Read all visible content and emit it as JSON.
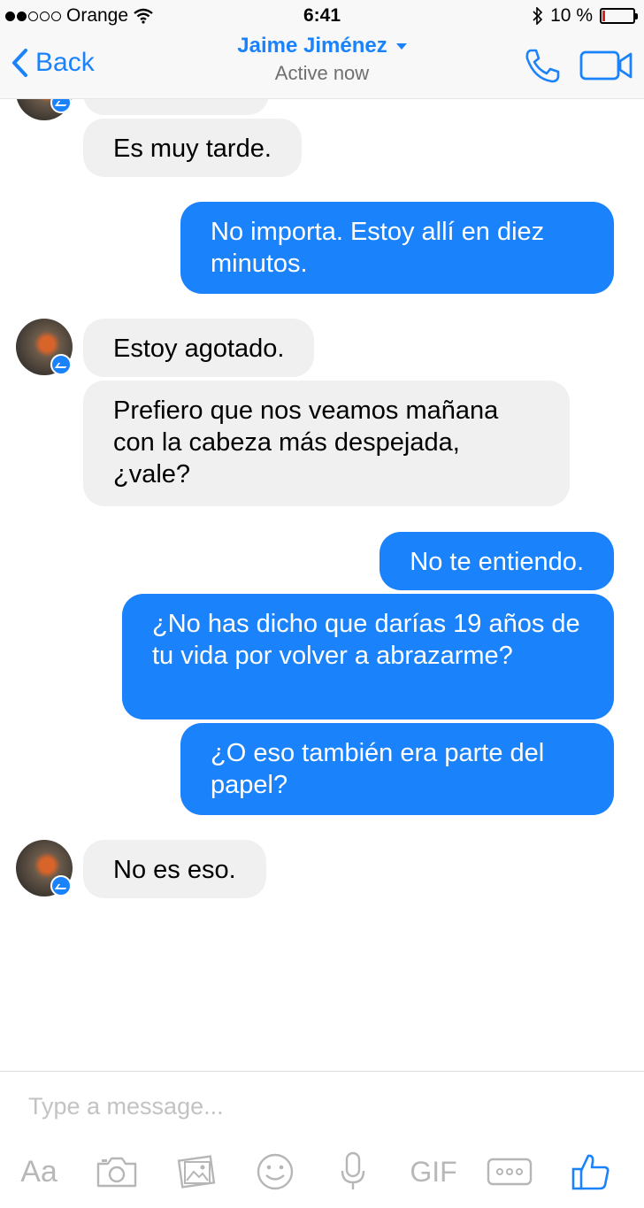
{
  "status_bar": {
    "carrier": "Orange",
    "time": "6:41",
    "battery": "10 %",
    "battery_level": 0.1
  },
  "nav": {
    "back_label": "Back",
    "contact_name": "Jaime Jiménez",
    "contact_status": "Active now"
  },
  "messages": [
    {
      "from": "contact",
      "text": "Es muy tarde."
    },
    {
      "from": "me",
      "text": "No importa. Estoy allí en diez minutos."
    },
    {
      "from": "contact",
      "text": "Estoy agotado."
    },
    {
      "from": "contact",
      "text": "Prefiero que nos veamos mañana con la cabeza más despejada, ¿vale?"
    },
    {
      "from": "me",
      "text": "No te entiendo."
    },
    {
      "from": "me",
      "text": "¿No has dicho que darías 19 años de tu vida por volver a abrazarme?"
    },
    {
      "from": "me",
      "text": "¿O eso también era parte del papel?"
    },
    {
      "from": "contact",
      "text": "No es eso."
    }
  ],
  "composer": {
    "placeholder": "Type a message...",
    "text_format_label": "Aa",
    "gif_label": "GIF"
  },
  "icons": {
    "toolbar": [
      "text-format-icon",
      "camera-icon",
      "gallery-icon",
      "emoji-icon",
      "microphone-icon",
      "gif-icon",
      "more-icon",
      "thumbs-up-icon"
    ],
    "nav": [
      "back-chevron-icon",
      "dropdown-caret-icon",
      "phone-icon",
      "video-camera-icon"
    ]
  },
  "colors": {
    "accent": "#1a82fb",
    "incoming_bubble": "#f1f0f0",
    "battery_low": "#e0201b"
  }
}
